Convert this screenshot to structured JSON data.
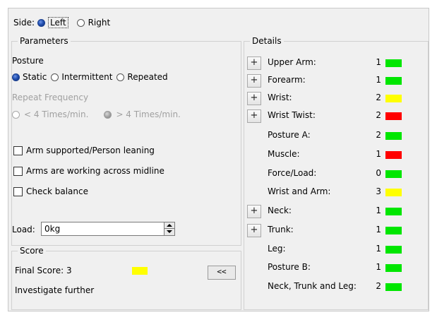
{
  "side": {
    "label": "Side:",
    "options": [
      {
        "label": "Left",
        "selected": true
      },
      {
        "label": "Right",
        "selected": false
      }
    ]
  },
  "parameters": {
    "title": "Parameters",
    "posture_label": "Posture",
    "posture_options": [
      {
        "label": "Static",
        "selected": true
      },
      {
        "label": "Intermittent",
        "selected": false
      },
      {
        "label": "Repeated",
        "selected": false
      }
    ],
    "repeat_frequency_label": "Repeat Frequency",
    "repeat_options": [
      {
        "label": "< 4 Times/min.",
        "selected": false
      },
      {
        "label": "> 4 Times/min.",
        "selected": true
      }
    ],
    "checkboxes": [
      {
        "label": "Arm supported/Person leaning",
        "checked": false
      },
      {
        "label": "Arms are working across midline",
        "checked": false
      },
      {
        "label": "Check balance",
        "checked": false
      }
    ],
    "load_label": "Load:",
    "load_value": "0kg"
  },
  "score": {
    "title": "Score",
    "final_score_text": "Final Score: 3",
    "final_score_color": "#ffff00",
    "message": "Investigate further",
    "collapse_button": "<<"
  },
  "details": {
    "title": "Details",
    "rows": [
      {
        "label": "Upper Arm:",
        "value": "1",
        "color": "#00e600",
        "expandable": true
      },
      {
        "label": "Forearm:",
        "value": "1",
        "color": "#00e600",
        "expandable": true
      },
      {
        "label": "Wrist:",
        "value": "2",
        "color": "#ffff00",
        "expandable": true
      },
      {
        "label": "Wrist Twist:",
        "value": "2",
        "color": "#ff0000",
        "expandable": true
      },
      {
        "label": "Posture A:",
        "value": "2",
        "color": "#00e600",
        "expandable": false
      },
      {
        "label": "Muscle:",
        "value": "1",
        "color": "#ff0000",
        "expandable": false
      },
      {
        "label": "Force/Load:",
        "value": "0",
        "color": "#00e600",
        "expandable": false
      },
      {
        "label": "Wrist and Arm:",
        "value": "3",
        "color": "#ffff00",
        "expandable": false
      },
      {
        "label": "Neck:",
        "value": "1",
        "color": "#00e600",
        "expandable": true
      },
      {
        "label": "Trunk:",
        "value": "1",
        "color": "#00e600",
        "expandable": true
      },
      {
        "label": "Leg:",
        "value": "1",
        "color": "#00e600",
        "expandable": false
      },
      {
        "label": "Posture B:",
        "value": "1",
        "color": "#00e600",
        "expandable": false
      },
      {
        "label": "Neck, Trunk and Leg:",
        "value": "2",
        "color": "#00e600",
        "expandable": false
      }
    ],
    "expand_button": "+"
  }
}
